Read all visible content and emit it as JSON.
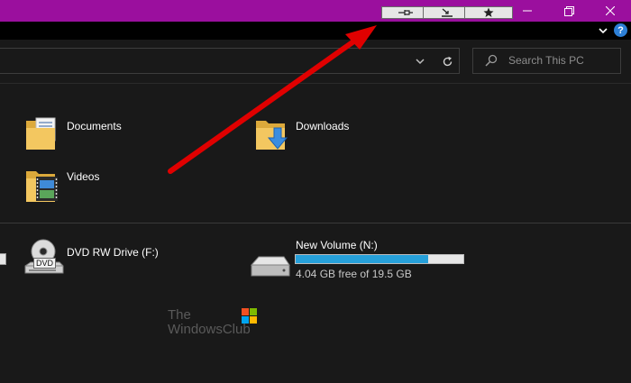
{
  "title_bar": {
    "extra_buttons": [
      {
        "icon": "pin-icon"
      },
      {
        "icon": "minimize-to-tray-icon"
      },
      {
        "icon": "star-icon"
      }
    ],
    "window_controls": [
      {
        "icon": "minimize-icon"
      },
      {
        "icon": "restore-icon"
      },
      {
        "icon": "close-icon"
      }
    ]
  },
  "ribbon": {
    "help_label": "?"
  },
  "search": {
    "placeholder": "Search This PC"
  },
  "folders": [
    {
      "label": "Documents",
      "icon": "documents-folder-icon"
    },
    {
      "label": "Downloads",
      "icon": "downloads-folder-icon"
    },
    {
      "label": "Videos",
      "icon": "videos-folder-icon"
    }
  ],
  "drives": [
    {
      "label": "DVD RW Drive (F:)",
      "icon": "dvd-drive-icon",
      "badge": "DVD"
    },
    {
      "label": "New Volume (N:)",
      "icon": "hard-drive-icon",
      "free_text": "4.04 GB free of 19.5 GB",
      "used_fraction": 0.79
    }
  ],
  "watermark": {
    "line1": "The",
    "line2": "WindowsClub"
  },
  "colors": {
    "title_bar": "#9b0f9e",
    "background": "#191919",
    "progress_fill": "#26a0da",
    "annotation_arrow": "#e00000"
  }
}
